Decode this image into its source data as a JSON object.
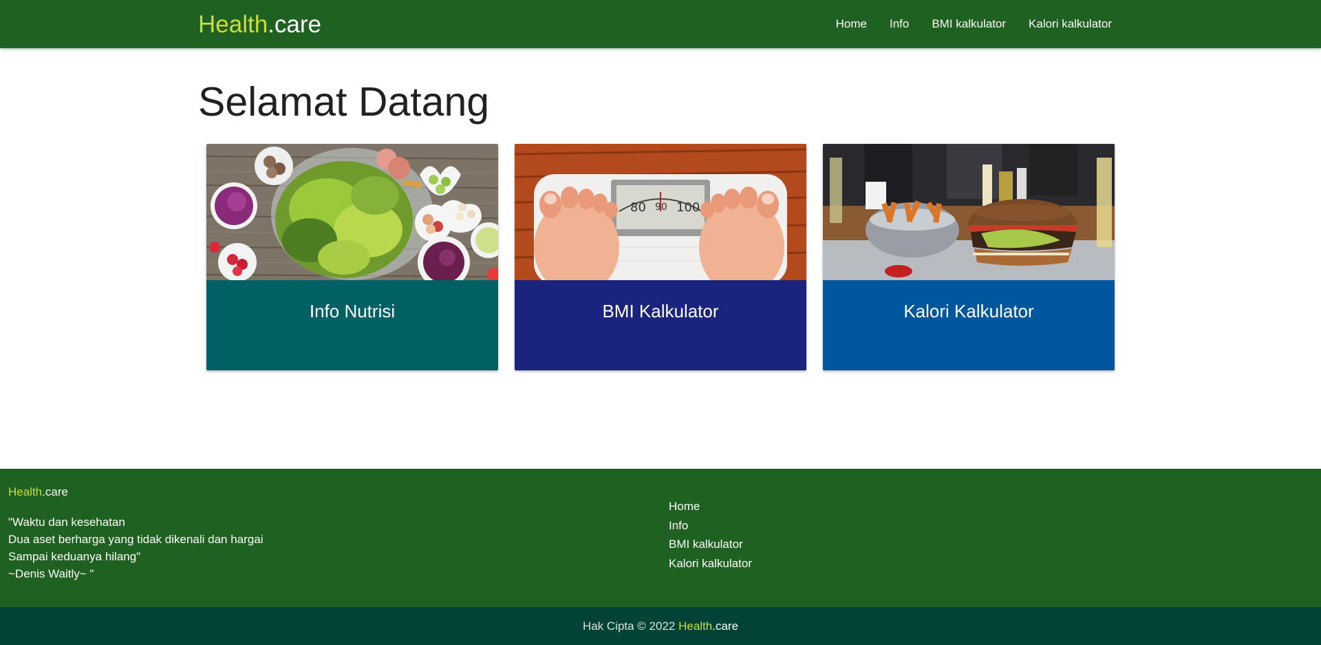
{
  "navbar": {
    "brand_highlight": "Health",
    "brand_rest": ".care",
    "links": [
      "Home",
      "Info",
      "BMI kalkulator",
      "Kalori kalkulator"
    ]
  },
  "main": {
    "title": "Selamat Datang",
    "cards": [
      {
        "title": "Info Nutrisi",
        "image": "salad-bowls-image",
        "color": "#006064"
      },
      {
        "title": "BMI Kalkulator",
        "image": "feet-on-scale-image",
        "color": "#1a237e"
      },
      {
        "title": "Kalori Kalkulator",
        "image": "burger-fries-image",
        "color": "#01579b"
      }
    ]
  },
  "footer": {
    "brand_highlight": "Health",
    "brand_rest": ".care",
    "quote_lines": [
      "\"Waktu dan kesehatan",
      "Dua aset berharga yang tidak dikenali dan hargai",
      "Sampai keduanya hilang\"",
      "~Denis Waitly~ \""
    ],
    "links": [
      "Home",
      "Info",
      "BMI kalkulator",
      "Kalori kalkulator"
    ],
    "copyright_prefix": "Hak Cipta © 2022",
    "copyright_brand_highlight": "Health",
    "copyright_brand_rest": ".care"
  },
  "colors": {
    "primary_green": "#1e6120",
    "footer_bottom": "#024335",
    "brand_accent": "#cddc39"
  }
}
